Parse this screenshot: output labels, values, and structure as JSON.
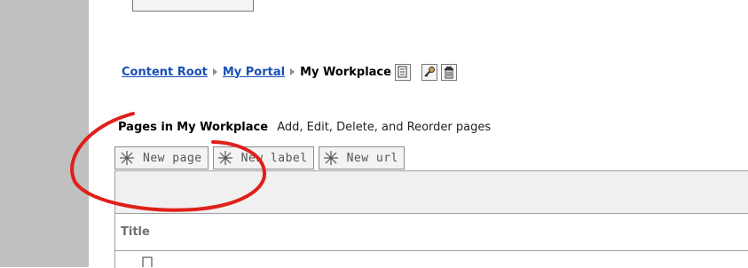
{
  "breadcrumb": {
    "items": [
      "Content Root",
      "My Portal"
    ],
    "current": "My Workplace"
  },
  "toolbar": {
    "icons": [
      "page-properties-icon",
      "permissions-key-icon",
      "trash-icon"
    ]
  },
  "pages_section": {
    "label": "Pages in",
    "portal_name": "My Workplace",
    "description": "Add, Edit, Delete, and Reorder pages"
  },
  "buttons": {
    "new_page": "New page",
    "new_label": "New label",
    "new_url": "New url"
  },
  "table": {
    "title_header": "Title"
  },
  "colors": {
    "link": "#1a4fb5",
    "annotation_red": "#e0201a",
    "gutter": "#c0c0c0"
  }
}
